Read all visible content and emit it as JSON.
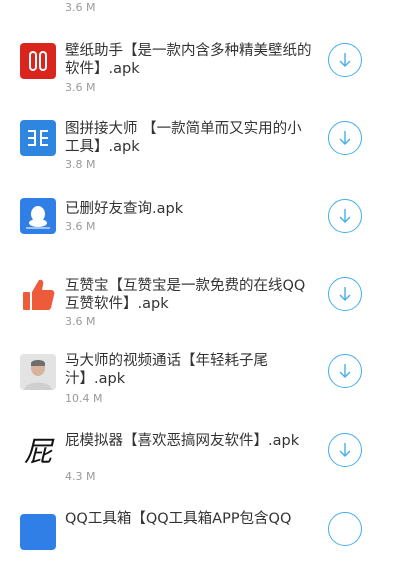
{
  "top_size": "3.6 M",
  "accent_color": "#45aeea",
  "items": [
    {
      "title": "壁纸助手【是一款内含多种精美壁纸的软件】.apk",
      "size": "3.6 M",
      "icon": "wallpaper-app-icon",
      "icon_color": "#d9251d"
    },
    {
      "title": "图拼接大师 【一款简单而又实用的小工具】.apk",
      "size": "3.8 M",
      "icon": "image-stitch-app-icon",
      "icon_color": "#2f86e0"
    },
    {
      "title": "已删好友查询.apk",
      "size": "3.6 M",
      "icon": "qq-penguin-app-icon",
      "icon_color": "#2f7fe6"
    },
    {
      "title": "互赞宝【互赞宝是一款免费的在线QQ互赞软件】.apk",
      "size": "3.6 M",
      "icon": "thumbs-up-app-icon",
      "icon_color": "#ee5b3a"
    },
    {
      "title": "马大师的视频通话【年轻耗子尾汁】.apk",
      "size": "10.4 M",
      "icon": "portrait-app-icon",
      "icon_color": "#c9c9c9"
    },
    {
      "title": "屁模拟器【喜欢恶搞网友软件】.apk",
      "size": "4.3 M",
      "icon": "calligraphy-app-icon",
      "icon_color": "#111111"
    },
    {
      "title": "QQ工具箱【QQ工具箱APP包含QQ",
      "size": "",
      "icon": "toolbox-app-icon",
      "icon_color": "#2f7fe6"
    }
  ]
}
